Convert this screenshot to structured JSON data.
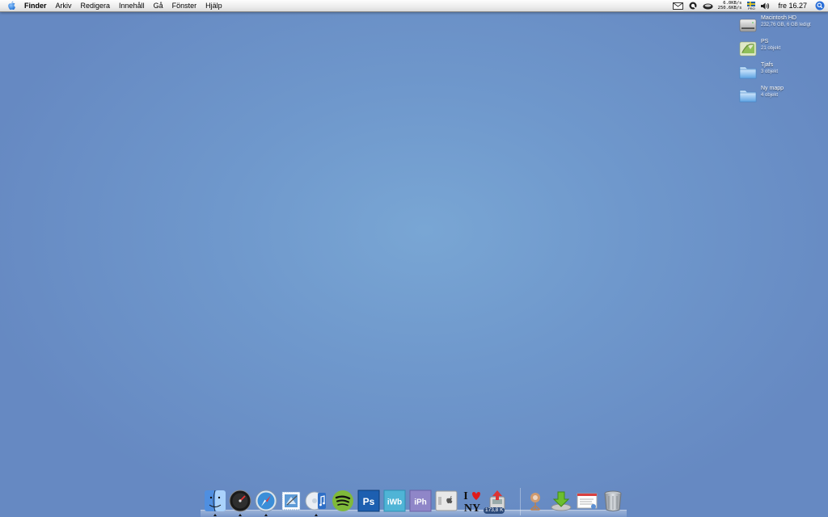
{
  "menubar": {
    "app_name": "Finder",
    "menus": [
      "Arkiv",
      "Redigera",
      "Innehåll",
      "Gå",
      "Fönster",
      "Hjälp"
    ],
    "status_icons": [
      "mail-icon",
      "quicksilver-icon",
      "coffee-icon",
      "network-meter-icon",
      "input-flag-icon",
      "volume-icon",
      "spotlight-icon"
    ],
    "net_up": "6.0KB/s",
    "net_down": "250.6KB/s",
    "input_label": "PRO",
    "clock": "fre 16.27"
  },
  "desktop": {
    "items": [
      {
        "name": "Macintosh HD",
        "info": "232,76 GB, 6 GB ledigt",
        "icon": "hard-drive-icon"
      },
      {
        "name": "PS",
        "info": "21 objekt",
        "icon": "image-folder-icon"
      },
      {
        "name": "Tjafs",
        "info": "3 objekt",
        "icon": "folder-icon"
      },
      {
        "name": "Ny mapp",
        "info": "4 objekt",
        "icon": "folder-icon"
      }
    ]
  },
  "dock": {
    "items": [
      "finder-icon",
      "dashboard-icon",
      "safari-icon",
      "mail-stamp-icon",
      "itunes-icon",
      "spotify-icon",
      "photoshop-icon",
      "iweb-icon",
      "iphoto-icon",
      "system-preferences-icon",
      "i-love-ny-icon",
      "transmission-icon",
      "network-folder-icon",
      "downloads-stack-icon",
      "documents-stack-icon",
      "trash-icon"
    ],
    "ps_label": "Ps",
    "iweb_label": "iWb",
    "iphoto_label": "iPh",
    "i_love_ny": [
      "I",
      "NY"
    ],
    "transfer_badge": "173,8 K"
  }
}
